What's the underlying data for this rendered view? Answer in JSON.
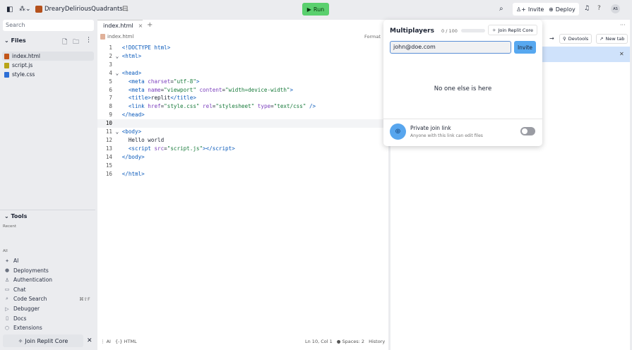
{
  "topbar": {
    "project": "DrearyDeliriousQuadrants",
    "run": "Run",
    "invite": "Invite",
    "deploy": "Deploy",
    "avatar": "AS"
  },
  "sidebar": {
    "search_placeholder": "Search",
    "files_title": "Files",
    "files": [
      {
        "name": "index.html",
        "color": "#c2561a"
      },
      {
        "name": "script.js",
        "color": "#b8a419"
      },
      {
        "name": "style.css",
        "color": "#2d6fd6"
      }
    ],
    "tools_title": "Tools",
    "recent": "Recent",
    "all": "All",
    "tools": [
      {
        "label": "AI",
        "icon": "✦"
      },
      {
        "label": "Deployments",
        "icon": "●"
      },
      {
        "label": "Authentication",
        "icon": "♙"
      },
      {
        "label": "Chat",
        "icon": "▭"
      },
      {
        "label": "Code Search",
        "icon": "⌕",
        "shortcut": "⌘⇧F"
      },
      {
        "label": "Debugger",
        "icon": "▷"
      },
      {
        "label": "Docs",
        "icon": "▯"
      },
      {
        "label": "Extensions",
        "icon": "⬡"
      }
    ],
    "join_core": "Join Replit Core"
  },
  "editor": {
    "tab": "index.html",
    "breadcrumb": "index.html",
    "format": "Format",
    "status": {
      "ai": "AI",
      "lang": "HTML",
      "position": "Ln 10, Col 1",
      "spaces": "Spaces: 2",
      "history": "History"
    }
  },
  "right": {
    "devtools": "Devtools",
    "new_tab": "New tab"
  },
  "popup": {
    "title": "Multiplayers",
    "count": "0 / 100",
    "count_fraction": 0,
    "join_core": "Join Replit Core",
    "email": "john@doe.com",
    "invite": "Invite",
    "empty": "No one else is here",
    "private_title": "Private join link",
    "private_desc": "Anyone with this link can edit files",
    "private_enabled": false
  }
}
